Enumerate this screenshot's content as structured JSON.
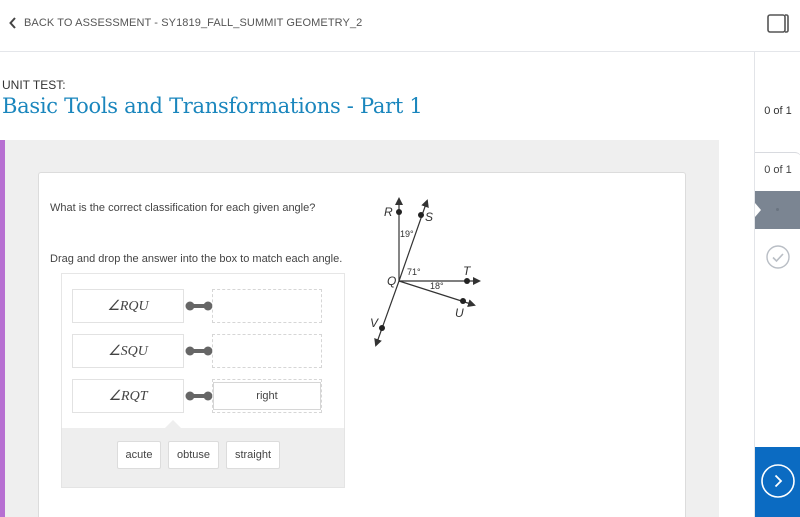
{
  "topbar": {
    "back_label": "BACK TO ASSESSMENT - SY1819_FALL_SUMMIT GEOMETRY_2",
    "icons": {
      "back": "chevron-left-icon",
      "window": "window-toggle-icon"
    }
  },
  "header": {
    "unit_label": "UNIT TEST:",
    "title": "Basic Tools and Transformations - Part 1"
  },
  "right_panel": {
    "overall_score": "0 of 1",
    "question_score": "0 of 1",
    "icons": {
      "status": "check-circle-icon",
      "next": "next-arrow-icon"
    }
  },
  "question": {
    "prompt": "What is the correct classification for each given angle?",
    "instruction": "Drag and drop the answer into the box to match each angle.",
    "pairs": [
      {
        "term": "∠RQU",
        "answer": ""
      },
      {
        "term": "∠SQU",
        "answer": ""
      },
      {
        "term": "∠RQT",
        "answer": "right"
      }
    ],
    "answer_bank": [
      "acute",
      "obtuse",
      "straight"
    ],
    "figure": {
      "points": [
        "R",
        "S",
        "Q",
        "T",
        "U",
        "V"
      ],
      "angles": {
        "RQS": "19°",
        "SQT": "71°",
        "TQU": "18°"
      }
    }
  },
  "colors": {
    "title": "#1a86bd",
    "accent_bar": "#b76fd2",
    "next_button": "#0b6bc2",
    "active_nav": "#7b8592"
  }
}
